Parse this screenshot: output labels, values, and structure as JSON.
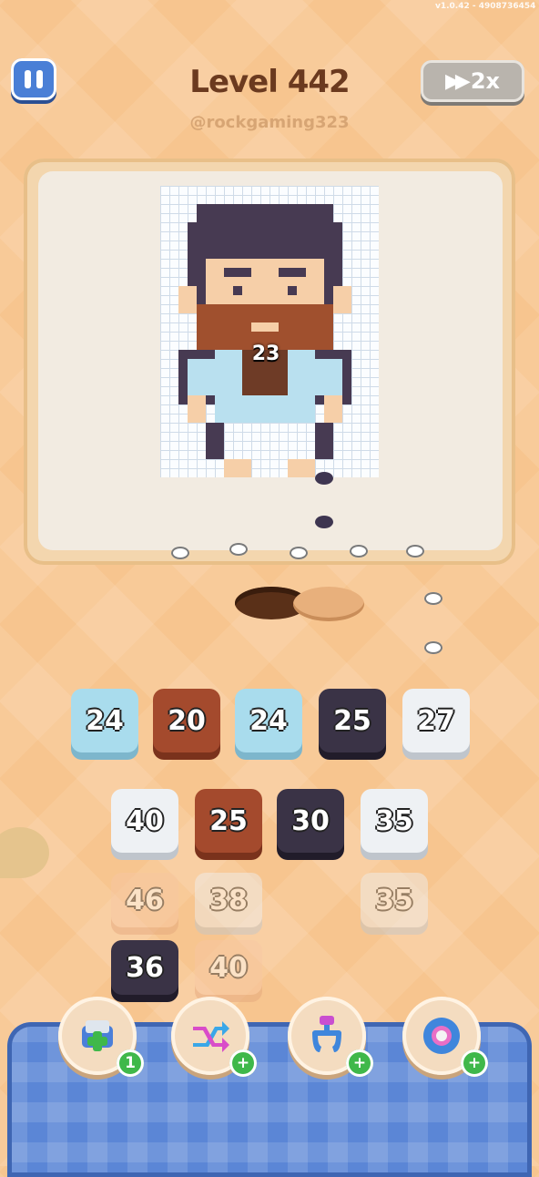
{
  "version": "v1.0.42 - 4908736454",
  "header": {
    "level_title": "Level 442",
    "username": "@rockgaming323",
    "speed_label": "2x"
  },
  "board": {
    "remaining_count": "23"
  },
  "top_row": [
    {
      "value": "24",
      "color": "light-blue"
    },
    {
      "value": "20",
      "color": "brown"
    },
    {
      "value": "24",
      "color": "light-blue"
    },
    {
      "value": "25",
      "color": "dark-purple"
    },
    {
      "value": "27",
      "color": "white"
    }
  ],
  "stack_row_1": [
    {
      "value": "40",
      "color": "white"
    },
    {
      "value": "25",
      "color": "brown"
    },
    {
      "value": "30",
      "color": "dark-purple"
    },
    {
      "value": "35",
      "color": "white"
    }
  ],
  "stack_row_2": [
    {
      "value": "46",
      "color": "peach"
    },
    {
      "value": "38",
      "color": "white"
    },
    {
      "value": "35",
      "color": "white"
    }
  ],
  "stack_row_3": [
    {
      "value": "36",
      "color": "dark-purple"
    },
    {
      "value": "40",
      "color": "peach"
    }
  ],
  "boosters": [
    {
      "icon": "add-tray-icon",
      "badge": "1"
    },
    {
      "icon": "shuffle-arrows-icon",
      "badge": "+"
    },
    {
      "icon": "magnet-claw-icon",
      "badge": "+"
    },
    {
      "icon": "bolt-screw-icon",
      "badge": "+"
    }
  ],
  "colors": {
    "background": "#f7c58f",
    "tray": "#5b86d6",
    "title": "#6b3a1f"
  }
}
